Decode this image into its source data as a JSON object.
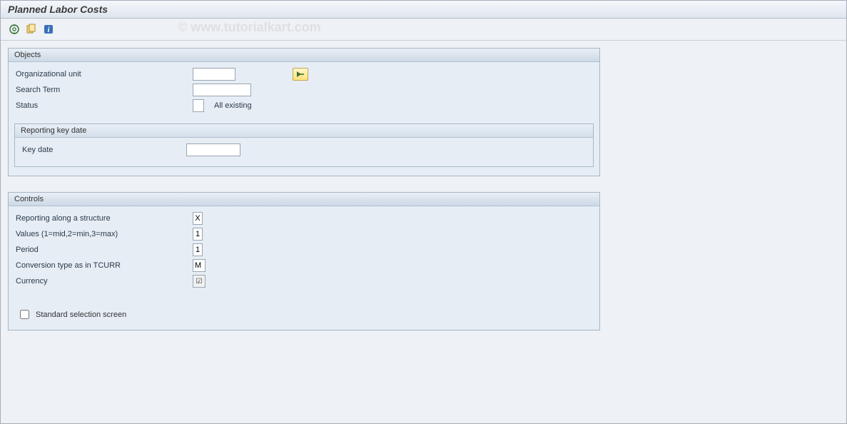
{
  "title": "Planned Labor Costs",
  "watermark": "© www.tutorialkart.com",
  "toolbar": {
    "execute_icon": "execute-icon",
    "variant_icon": "variant-icon",
    "info_icon": "info-icon"
  },
  "objects": {
    "title": "Objects",
    "org_unit_label": "Organizational unit",
    "org_unit_value": "",
    "search_term_label": "Search Term",
    "search_term_value": "",
    "status_label": "Status",
    "status_value": "",
    "status_text": "All existing",
    "reporting_key_date": {
      "title": "Reporting key date",
      "key_date_label": "Key date",
      "key_date_value": ""
    }
  },
  "controls": {
    "title": "Controls",
    "reporting_structure_label": "Reporting along a structure",
    "reporting_structure_value": "X",
    "values_label": "Values (1=mid,2=min,3=max)",
    "values_value": "1",
    "period_label": "Period",
    "period_value": "1",
    "conversion_label": "Conversion type as in TCURR",
    "conversion_value": "M",
    "currency_label": "Currency",
    "currency_checked": "☑",
    "std_selection_label": "Standard selection screen"
  }
}
